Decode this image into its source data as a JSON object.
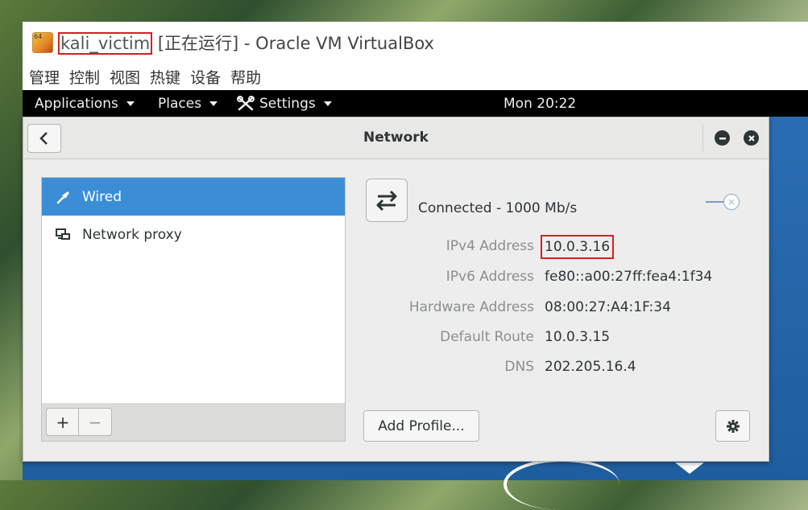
{
  "window": {
    "vm_name": "kali_victim",
    "title_rest": " [正在运行] - Oracle VM VirtualBox",
    "icon_badge": "64"
  },
  "vbox_menu": [
    "管理",
    "控制",
    "视图",
    "热键",
    "设备",
    "帮助"
  ],
  "topbar": {
    "applications": "Applications",
    "places": "Places",
    "settings": "Settings",
    "clock": "Mon 20:22"
  },
  "dialog": {
    "title": "Network",
    "back_icon": "chevron-left-icon",
    "minimize_icon": "minimize-icon",
    "close_icon": "close-icon"
  },
  "sidebar": {
    "items": [
      {
        "label": "Wired",
        "icon": "wired-plug-icon",
        "selected": true
      },
      {
        "label": "Network proxy",
        "icon": "network-proxy-icon",
        "selected": false
      }
    ],
    "add_label": "+",
    "remove_label": "−"
  },
  "connection": {
    "status": "Connected - 1000 Mb/s",
    "switch_on": false,
    "rows": [
      {
        "label": "IPv4 Address",
        "value": "10.0.3.16",
        "highlighted": true
      },
      {
        "label": "IPv6 Address",
        "value": "fe80::a00:27ff:fea4:1f34",
        "highlighted": false
      },
      {
        "label": "Hardware Address",
        "value": "08:00:27:A4:1F:34",
        "highlighted": false
      },
      {
        "label": "Default Route",
        "value": "10.0.3.15",
        "highlighted": false
      },
      {
        "label": "DNS",
        "value": "202.205.16.4",
        "highlighted": false
      }
    ]
  },
  "buttons": {
    "add_profile": "Add Profile...",
    "settings_icon": "gear-icon"
  },
  "colors": {
    "selection": "#3b8ed6",
    "highlight_box": "#d42020"
  }
}
